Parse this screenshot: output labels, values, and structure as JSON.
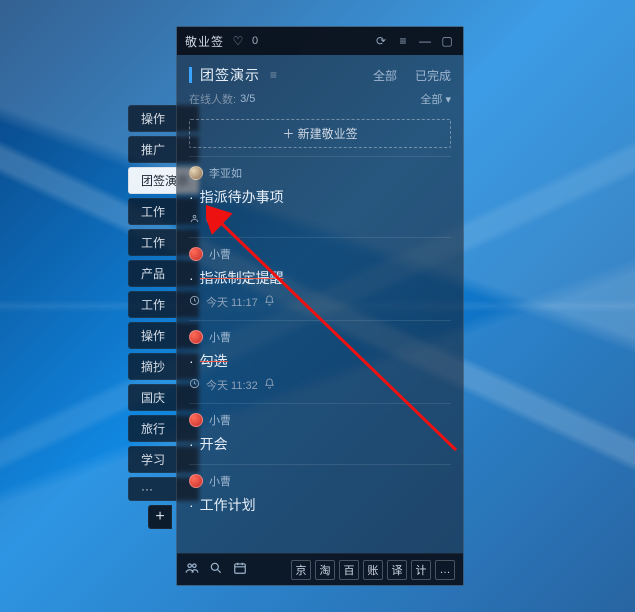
{
  "titlebar": {
    "brand": "敬业签",
    "bell": "♤",
    "bell_count": "0"
  },
  "header": {
    "title": "团签演示",
    "list_icon": "≡",
    "link_all": "全部",
    "link_done": "已完成"
  },
  "subline": {
    "label": "在线人数:",
    "count": "3/5",
    "filter": "全部 ▾"
  },
  "newbtn_label": "＋ 新建敬业签",
  "cards": [
    {
      "owner": "李亚如",
      "avatar": "photo",
      "title": "指派待办事项",
      "strike": false,
      "meta_icon": "person",
      "meta": "0/3"
    },
    {
      "owner": "小曹",
      "avatar": "red",
      "title": "指派制定提醒",
      "strike": true,
      "meta_icon": "clock",
      "meta": "今天 11:17",
      "bell": true
    },
    {
      "owner": "小曹",
      "avatar": "red",
      "title": "勾选",
      "strike": true,
      "meta_icon": "clock",
      "meta": "今天 11:32",
      "bell": true
    },
    {
      "owner": "小曹",
      "avatar": "red",
      "title": "开会",
      "strike": false
    },
    {
      "owner": "小曹",
      "avatar": "red",
      "title": "工作计划",
      "strike": false
    }
  ],
  "side_tabs": [
    "操作",
    "推广",
    "团签演示",
    "工作",
    "工作",
    "产品",
    "工作",
    "操作",
    "摘抄",
    "国庆",
    "旅行",
    "学习",
    "···"
  ],
  "side_active_index": 2,
  "bottom_tiles": [
    "京",
    "淘",
    "百",
    "账",
    "译",
    "计",
    "…"
  ]
}
